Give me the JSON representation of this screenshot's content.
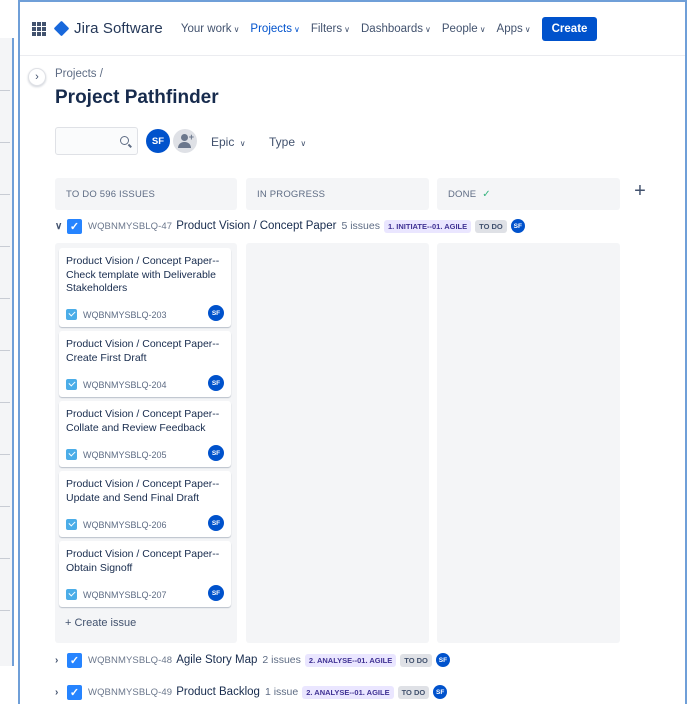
{
  "nav": {
    "logo": "Jira Software",
    "items": [
      {
        "label": "Your work",
        "active": false
      },
      {
        "label": "Projects",
        "active": true
      },
      {
        "label": "Filters",
        "active": false
      },
      {
        "label": "Dashboards",
        "active": false
      },
      {
        "label": "People",
        "active": false
      },
      {
        "label": "Apps",
        "active": false
      }
    ],
    "create": "Create"
  },
  "breadcrumb": "Projects  /",
  "title": "Project Pathfinder",
  "toolbar": {
    "avatar": "SF",
    "filter_epic": "Epic",
    "filter_type": "Type"
  },
  "columns": {
    "todo": "TO DO 596 ISSUES",
    "inprogress": "IN PROGRESS",
    "done": "DONE"
  },
  "swimlanes": [
    {
      "key": "WQBNMYSBLQ-47",
      "summary": "Product Vision / Concept Paper",
      "count": "5 issues",
      "label": "1. INITIATE--01. AGILE",
      "status": "TO DO",
      "avatar": "SF"
    },
    {
      "key": "WQBNMYSBLQ-48",
      "summary": "Agile Story Map",
      "count": "2 issues",
      "label": "2. ANALYSE--01. AGILE",
      "status": "TO DO",
      "avatar": "SF"
    },
    {
      "key": "WQBNMYSBLQ-49",
      "summary": "Product Backlog",
      "count": "1 issue",
      "label": "2. ANALYSE--01. AGILE",
      "status": "TO DO",
      "avatar": "SF"
    }
  ],
  "cards": [
    {
      "title": "Product Vision / Concept Paper--Check template with Deliverable Stakeholders",
      "key": "WQBNMYSBLQ-203",
      "avatar": "SF"
    },
    {
      "title": "Product Vision / Concept Paper--Create First Draft",
      "key": "WQBNMYSBLQ-204",
      "avatar": "SF"
    },
    {
      "title": "Product Vision / Concept Paper--Collate and Review Feedback",
      "key": "WQBNMYSBLQ-205",
      "avatar": "SF"
    },
    {
      "title": "Product Vision / Concept Paper--Update and Send Final Draft",
      "key": "WQBNMYSBLQ-206",
      "avatar": "SF"
    },
    {
      "title": "Product Vision / Concept Paper--Obtain Signoff",
      "key": "WQBNMYSBLQ-207",
      "avatar": "SF"
    }
  ],
  "create_issue": "+ Create issue",
  "colors": {
    "brand": "#0052cc",
    "checkbox": "#2684ff",
    "lozenge_bg": "#eae6ff",
    "lozenge_fg": "#403294"
  }
}
